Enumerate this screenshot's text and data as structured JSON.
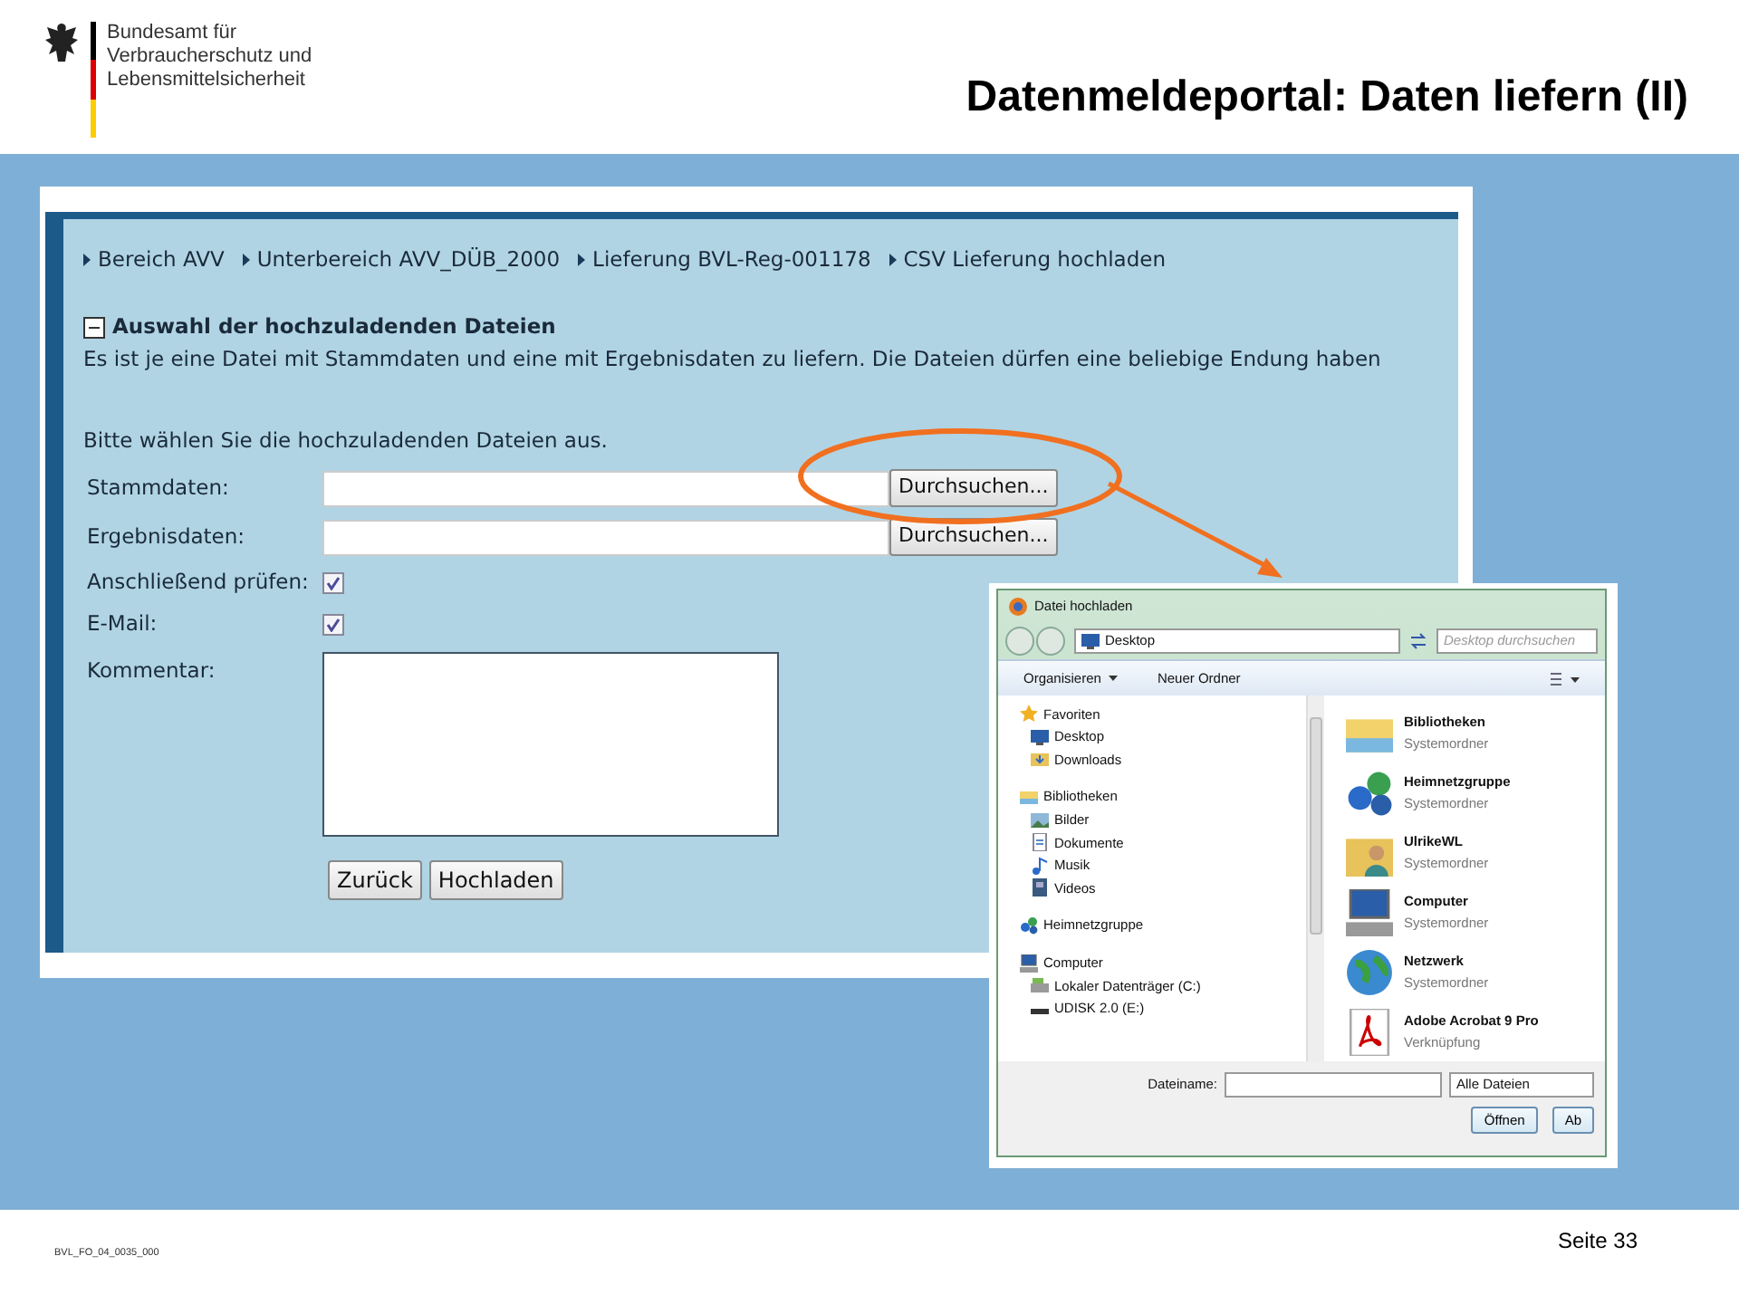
{
  "header": {
    "org_lines": [
      "Bundesamt für",
      "Verbraucherschutz und",
      "Lebensmittelsicherheit"
    ],
    "title": "Datenmeldeportal: Daten liefern (II)"
  },
  "web_form": {
    "breadcrumb": [
      "Bereich AVV",
      "Unterbereich AVV_DÜB_2000",
      "Lieferung BVL-Reg-001178",
      "CSV Lieferung hochladen"
    ],
    "section": {
      "title": "Auswahl der hochzuladenden Dateien",
      "expanded": true
    },
    "description": "Es ist je eine Datei mit Stammdaten und eine mit Ergebnisdaten zu liefern. Die Dateien dürfen eine beliebige Endung haben",
    "instruction": "Bitte wählen Sie die hochzuladenden Dateien aus.",
    "file_fields": [
      {
        "label": "Stammdaten:",
        "button": "Durchsuchen..."
      },
      {
        "label": "Ergebnisdaten:",
        "button": "Durchsuchen..."
      }
    ],
    "checkboxes": [
      {
        "label": "Anschließend prüfen:",
        "checked": true
      },
      {
        "label": "E-Mail:",
        "checked": true
      }
    ],
    "comment_label": "Kommentar:",
    "buttons": [
      "Zurück",
      "Hochladen"
    ]
  },
  "file_dialog": {
    "title": "Datei hochladen",
    "address": "Desktop",
    "search_placeholder": "Desktop durchsuchen",
    "toolbar": [
      {
        "label": "Organisieren",
        "dropdown": true
      },
      {
        "label": "Neuer Ordner",
        "dropdown": false
      }
    ],
    "nav": [
      {
        "label": "Favoriten",
        "kind": "star",
        "children": [
          {
            "label": "Desktop",
            "kind": "desktop"
          },
          {
            "label": "Downloads",
            "kind": "download"
          }
        ]
      },
      {
        "label": "Bibliotheken",
        "kind": "library",
        "children": [
          {
            "label": "Bilder",
            "kind": "image"
          },
          {
            "label": "Dokumente",
            "kind": "doc"
          },
          {
            "label": "Musik",
            "kind": "music"
          },
          {
            "label": "Videos",
            "kind": "video"
          }
        ]
      },
      {
        "label": "Heimnetzgruppe",
        "kind": "homegroup"
      },
      {
        "label": "Computer",
        "kind": "computer",
        "children": [
          {
            "label": "Lokaler Datenträger (C:)",
            "kind": "drive"
          },
          {
            "label": "UDISK 2.0 (E:)",
            "kind": "usb"
          }
        ]
      }
    ],
    "items": [
      {
        "name": "Bibliotheken",
        "type": "Systemordner",
        "kind": "library"
      },
      {
        "name": "Heimnetzgruppe",
        "type": "Systemordner",
        "kind": "homegroup"
      },
      {
        "name": "UlrikeWL",
        "type": "Systemordner",
        "kind": "user"
      },
      {
        "name": "Computer",
        "type": "Systemordner",
        "kind": "computer"
      },
      {
        "name": "Netzwerk",
        "type": "Systemordner",
        "kind": "globe"
      },
      {
        "name": "Adobe Acrobat 9 Pro",
        "type": "Verknüpfung",
        "kind": "pdf"
      }
    ],
    "filename_label": "Dateiname:",
    "filetype": "Alle Dateien",
    "buttons": [
      "Öffnen",
      "Ab"
    ]
  },
  "footer": {
    "doc_code": "BVL_FO_04_0035_000",
    "page": "Seite 33"
  }
}
